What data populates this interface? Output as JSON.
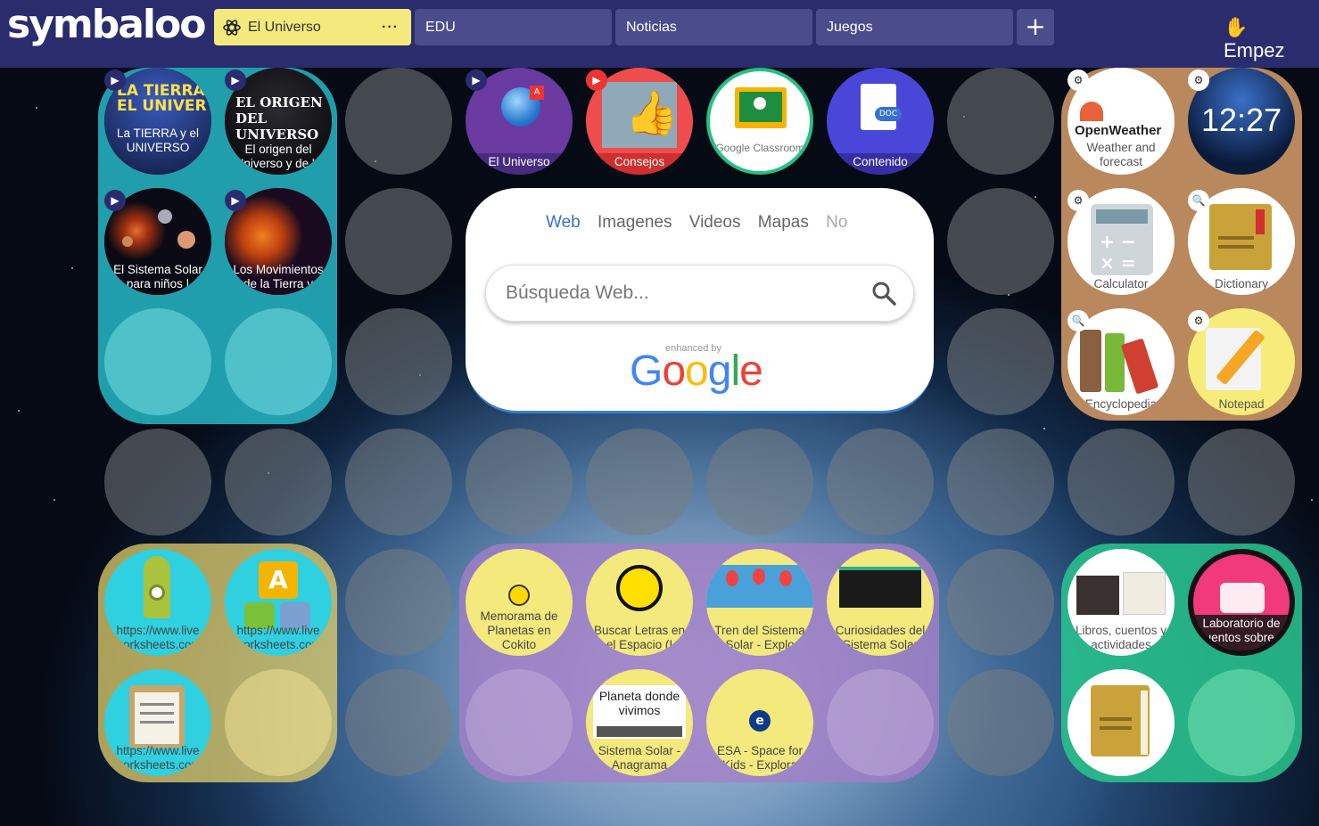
{
  "app": {
    "logo_text": "symbaloo"
  },
  "tabs": [
    {
      "label": "El Universo",
      "more": "···"
    },
    {
      "label": "EDU"
    },
    {
      "label": "Noticias"
    },
    {
      "label": "Juegos"
    }
  ],
  "add_tab_label": "+",
  "start_label": "Empez",
  "search": {
    "tabs": [
      "Web",
      "Imagenes",
      "Videos",
      "Mapas",
      "No"
    ],
    "placeholder": "Búsqueda Web...",
    "enhanced_by": "enhanced by",
    "brand": "Google"
  },
  "tiles": {
    "tierra": "La TIERRA y el UNIVERSO",
    "origen": "El origen del Universo y de la",
    "sistema": "El Sistema Solar para niños |",
    "movimientos": "Los Movimientos de la Tierra y",
    "universo": "El Universo",
    "consejos": "Consejos",
    "classroom": "Google Classroom",
    "contenido": "Contenido",
    "weather": "Weather and forecast",
    "weather_brand": "OpenWeather",
    "clock": "12:27",
    "calculator": "Calculator",
    "dictionary": "Dictionary",
    "encyclopedia": "Encyclopedia",
    "notepad": "Notepad",
    "ws1": "https://www.live worksheets.com",
    "ws2": "https://www.live worksheets.com",
    "ws3": "https://www.live worksheets.com",
    "memorama": "Memorama de Planetas en Cokito",
    "buscar": "Buscar Letras en el Espacio (I",
    "tren": "Tren del Sistema Solar - Explo",
    "curiosidades": "Curiosidades del Sistema Solar",
    "planeta": "Planeta donde vivimos",
    "anagrama": "Sistema Solar - Anagrama",
    "esa": "ESA - Space for Kids - Explora",
    "libros": "Libros, cuentos y actividades",
    "laboratorio": "Laboratorio de cuentos sobre e"
  },
  "colors": {
    "header": "#2a2c6e",
    "active_tab": "#f3e97d",
    "accent_blue": "#3a6fd0"
  }
}
